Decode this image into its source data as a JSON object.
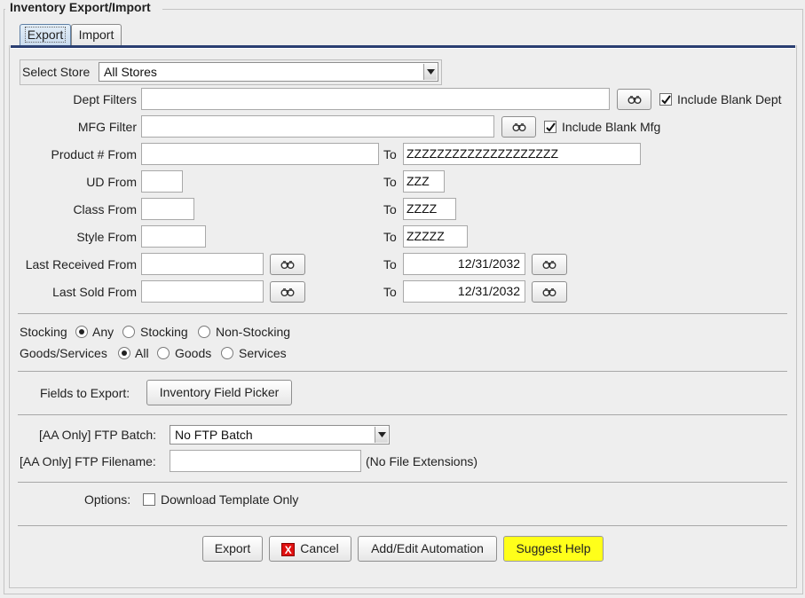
{
  "title": "Inventory Export/Import",
  "tabs": [
    {
      "label": "Export",
      "active": true
    },
    {
      "label": "Import",
      "active": false
    }
  ],
  "store": {
    "label": "Select Store",
    "value": "All Stores"
  },
  "dept": {
    "label": "Dept Filters",
    "value": "",
    "include_label": "Include Blank Dept",
    "include_checked": true
  },
  "mfg": {
    "label": "MFG Filter",
    "value": "",
    "include_label": "Include Blank Mfg",
    "include_checked": true
  },
  "product": {
    "label": "Product # From",
    "from": "",
    "to_label": "To",
    "to": "ZZZZZZZZZZZZZZZZZZZZ"
  },
  "ud": {
    "label": "UD From",
    "from": "",
    "to_label": "To",
    "to": "ZZZ"
  },
  "class": {
    "label": "Class From",
    "from": "",
    "to_label": "To",
    "to": "ZZZZ"
  },
  "style": {
    "label": "Style From",
    "from": "",
    "to_label": "To",
    "to": "ZZZZZ"
  },
  "last_received": {
    "label": "Last Received From",
    "from": "",
    "to_label": "To",
    "to": "12/31/2032"
  },
  "last_sold": {
    "label": "Last Sold From",
    "from": "",
    "to_label": "To",
    "to": "12/31/2032"
  },
  "stocking": {
    "label": "Stocking",
    "options": [
      {
        "label": "Any",
        "selected": true
      },
      {
        "label": "Stocking",
        "selected": false
      },
      {
        "label": "Non-Stocking",
        "selected": false
      }
    ]
  },
  "goods": {
    "label": "Goods/Services",
    "options": [
      {
        "label": "All",
        "selected": true
      },
      {
        "label": "Goods",
        "selected": false
      },
      {
        "label": "Services",
        "selected": false
      }
    ]
  },
  "fields": {
    "label": "Fields to Export:",
    "button": "Inventory Field Picker"
  },
  "ftp_batch": {
    "label": "[AA Only] FTP Batch:",
    "value": "No FTP Batch"
  },
  "ftp_filename": {
    "label": "[AA Only] FTP Filename:",
    "value": "",
    "hint": "(No File Extensions)"
  },
  "options": {
    "label": "Options:",
    "checkbox_label": "Download Template Only",
    "checked": false
  },
  "buttons": {
    "export": "Export",
    "cancel": "Cancel",
    "automation": "Add/Edit Automation",
    "suggest": "Suggest Help"
  },
  "colors": {
    "accent_tab": "#c9dbee",
    "suggest_bg": "#ffff1a",
    "cancel_icon": "#e01010",
    "tab_underline": "#2a3f72"
  }
}
